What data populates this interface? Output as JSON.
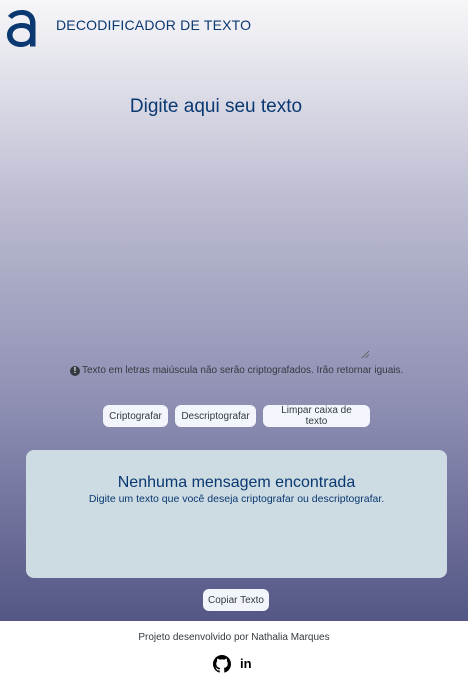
{
  "header": {
    "logo_icon": "alura-a-logo-icon",
    "title": "DECODIFICADOR DE TEXTO"
  },
  "input": {
    "placeholder": "Digite aqui seu texto",
    "value": ""
  },
  "warning": {
    "icon": "exclamation-circle-icon",
    "text": "Texto em letras maiúscula não serão criptografados. Irão retornar iguais."
  },
  "buttons": {
    "encrypt": "Criptografar",
    "decrypt": "Descriptografar",
    "clear": "Limpar caixa de texto",
    "copy": "Copiar Texto"
  },
  "result": {
    "title": "Nenhuma mensagem encontrada",
    "subtitle": "Digite um texto que você deseja criptografar ou descriptografar."
  },
  "footer": {
    "credit": "Projeto desenvolvido por Nathalia Marques",
    "github_icon": "github-icon",
    "linkedin_label": "in"
  },
  "colors": {
    "primary": "#0a3871",
    "result_background": "#cddbe3",
    "button_background": "#f3f5fc"
  }
}
